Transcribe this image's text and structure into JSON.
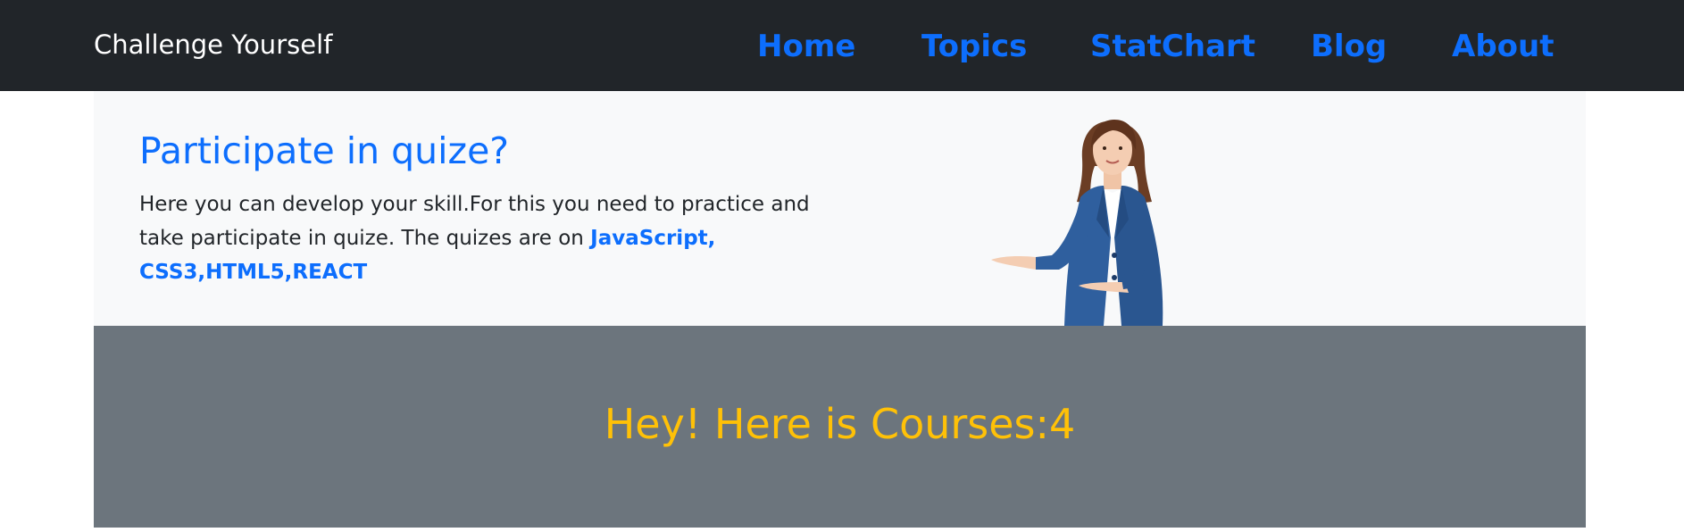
{
  "navbar": {
    "brand": "Challenge Yourself",
    "links": [
      "Home",
      "Topics",
      "StatChart",
      "Blog",
      "About"
    ],
    "link_color": "#0d6efd",
    "background": "#212529"
  },
  "hero": {
    "title": "Participate in quize?",
    "text_prefix": "Here you can develop your skill.For this you need to practice and take participate in quize. The quizes are on ",
    "topics": "JavaScript, CSS3,HTML5,REACT",
    "image_icon": "businesswoman-presenting-illustration",
    "background": "#f8f9fa"
  },
  "courses": {
    "prefix": "Hey! Here is Courses:",
    "count": "4",
    "text_color": "#ffc107",
    "background": "#6c757d"
  }
}
